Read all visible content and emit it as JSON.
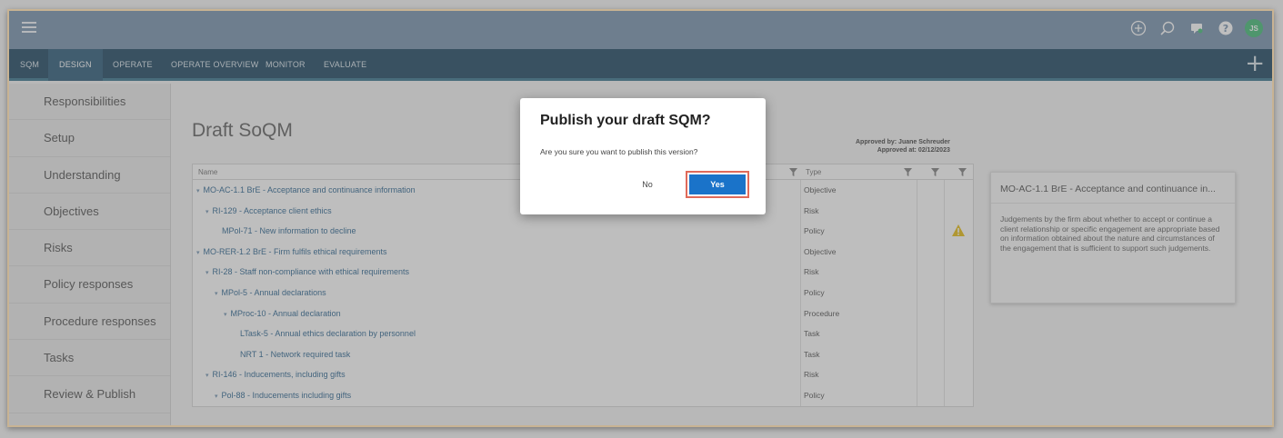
{
  "topbar": {
    "icons": [
      "menu-icon",
      "add-circle-icon",
      "search-icon",
      "chat-icon",
      "help-icon"
    ],
    "avatar_initials": "JS",
    "avatar_color": "#35b66c"
  },
  "nav": {
    "tabs": [
      {
        "label": "SQM"
      },
      {
        "label": "DESIGN"
      },
      {
        "label": "OPERATE"
      },
      {
        "label": "OPERATE OVERVIEW"
      },
      {
        "label": "MONITOR"
      },
      {
        "label": "EVALUATE"
      }
    ],
    "active_tab": "DESIGN",
    "plus": "+"
  },
  "sidebar": {
    "items": [
      {
        "label": "Responsibilities"
      },
      {
        "label": "Setup"
      },
      {
        "label": "Understanding"
      },
      {
        "label": "Objectives"
      },
      {
        "label": "Risks"
      },
      {
        "label": "Policy responses"
      },
      {
        "label": "Procedure responses"
      },
      {
        "label": "Tasks"
      },
      {
        "label": "Review & Publish"
      }
    ]
  },
  "page": {
    "title": "Draft SoQM",
    "approved_by": "Approved by: Juane Schreuder",
    "approved_at": "Approved at: 02/12/2023"
  },
  "grid": {
    "columns": {
      "name": "Name",
      "type": "Type"
    },
    "rows": [
      {
        "name": "MO-AC-1.1 BrE - Acceptance and continuance information",
        "type": "Objective",
        "caret": "▾",
        "warning": false
      },
      {
        "name": "RI-129 - Acceptance client ethics",
        "type": "Risk",
        "caret": "▾",
        "warning": false
      },
      {
        "name": "MPol-71 - New information to decline",
        "type": "Policy",
        "caret": "",
        "warning": true
      },
      {
        "name": "MO-RER-1.2 BrE - Firm fulfils ethical requirements",
        "type": "Objective",
        "caret": "▾",
        "warning": false
      },
      {
        "name": "RI-28 - Staff non-compliance with ethical requirements",
        "type": "Risk",
        "caret": "▾",
        "warning": false
      },
      {
        "name": "MPol-5 - Annual declarations",
        "type": "Policy",
        "caret": "▾",
        "warning": false
      },
      {
        "name": "MProc-10 - Annual declaration",
        "type": "Procedure",
        "caret": "▾",
        "warning": false
      },
      {
        "name": "LTask-5 - Annual ethics declaration by personnel",
        "type": "Task",
        "caret": "",
        "warning": false
      },
      {
        "name": "NRT 1 - Network required task",
        "type": "Task",
        "caret": "",
        "warning": false
      },
      {
        "name": "RI-146 - Inducements, including gifts",
        "type": "Risk",
        "caret": "▾",
        "warning": false
      },
      {
        "name": "Pol-88 - Inducements including gifts",
        "type": "Policy",
        "caret": "▾",
        "warning": false
      }
    ]
  },
  "detail": {
    "title": "MO-AC-1.1 BrE - Acceptance and continuance in...",
    "description": "Judgements by the firm about whether to accept or continue a client relationship or specific engagement are appropriate based on information obtained about the nature and circumstances of the engagement that is sufficient to support such judgements."
  },
  "dialog": {
    "title": "Publish your draft SQM?",
    "message": "Are you sure you want to publish this version?",
    "no_label": "No",
    "yes_label": "Yes"
  },
  "colors": {
    "topbar": "#6d8aa8",
    "navbar": "#0e3a57",
    "primary_button": "#1a73c9",
    "highlight_border": "#e06a5a",
    "link_text": "#1c5a89",
    "warning": "#e6b800"
  }
}
